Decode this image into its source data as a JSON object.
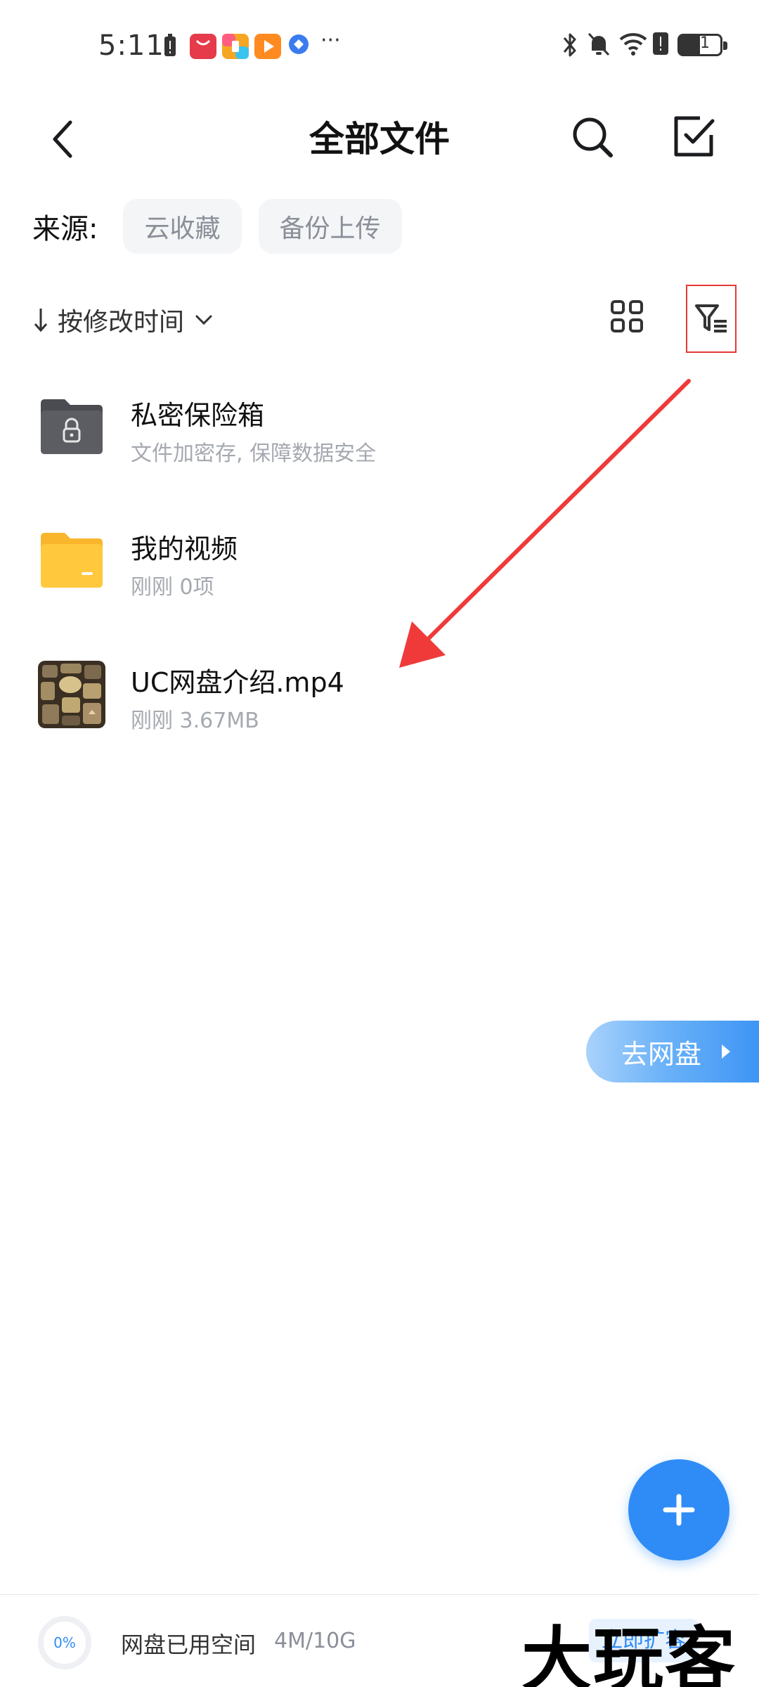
{
  "status_bar": {
    "time": "5:11",
    "more": "···",
    "battery": "51"
  },
  "header": {
    "title": "全部文件"
  },
  "source": {
    "label": "来源:",
    "chips": [
      "云收藏",
      "备份上传"
    ]
  },
  "sort": {
    "label": "按修改时间"
  },
  "files": [
    {
      "name": "私密保险箱",
      "meta": "文件加密存, 保障数据安全",
      "icon": "lock-folder-icon"
    },
    {
      "name": "我的视频",
      "meta": "刚刚  0项",
      "icon": "folder-icon"
    },
    {
      "name": "UC网盘介绍.mp4",
      "meta": "刚刚  3.67MB",
      "icon": "video-thumbnail"
    }
  ],
  "go_pan": {
    "label": "去网盘"
  },
  "storage": {
    "percent_label": "0%",
    "label": "网盘已用空间",
    "value": "4M/10G",
    "expand_label": "立即扩容"
  },
  "watermark": "大玩客",
  "colors": {
    "accent": "#2f8cf6",
    "highlight_box": "#e53935",
    "annotation_arrow": "#f03a3a",
    "folder_yellow": "#ffc83d"
  }
}
